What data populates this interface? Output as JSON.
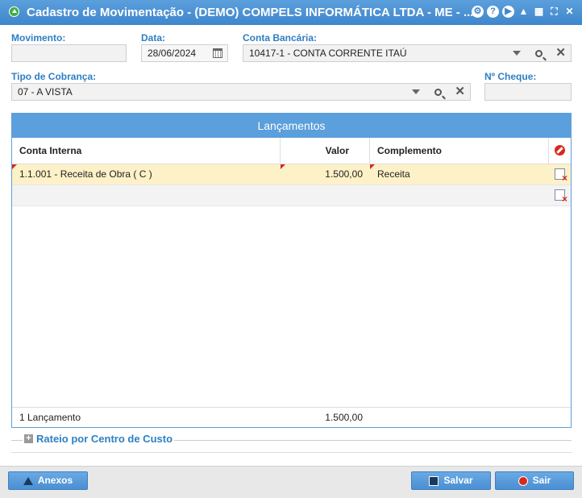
{
  "window": {
    "title": "Cadastro de Movimentação - (DEMO) COMPELS INFORMÁTICA LTDA - ME - ..."
  },
  "form": {
    "movimento": {
      "label": "Movimento:",
      "value": ""
    },
    "data": {
      "label": "Data:",
      "value": "28/06/2024"
    },
    "conta_bancaria": {
      "label": "Conta Bancária:",
      "value": "10417-1 - CONTA CORRENTE ITAÚ"
    },
    "tipo_cobranca": {
      "label": "Tipo de Cobrança:",
      "value": "07 - A VISTA"
    },
    "n_cheque": {
      "label": "Nº Cheque:",
      "value": ""
    }
  },
  "lancamentos": {
    "title": "Lançamentos",
    "columns": [
      "Conta Interna",
      "Valor",
      "Complemento"
    ],
    "rows": [
      {
        "conta": "1.1.001 - Receita de Obra ( C )",
        "valor": "1.500,00",
        "complemento": "Receita"
      },
      {
        "conta": "",
        "valor": "",
        "complemento": ""
      }
    ],
    "footer": {
      "count": "1 Lançamento",
      "total": "1.500,00"
    }
  },
  "rateio": {
    "label": "Rateio por Centro de Custo"
  },
  "buttons": {
    "anexos": "Anexos",
    "salvar": "Salvar",
    "sair": "Sair"
  },
  "colors": {
    "accent": "#5b9fdc",
    "label": "#2d7fc4",
    "selected_row": "#fdf1c8"
  }
}
